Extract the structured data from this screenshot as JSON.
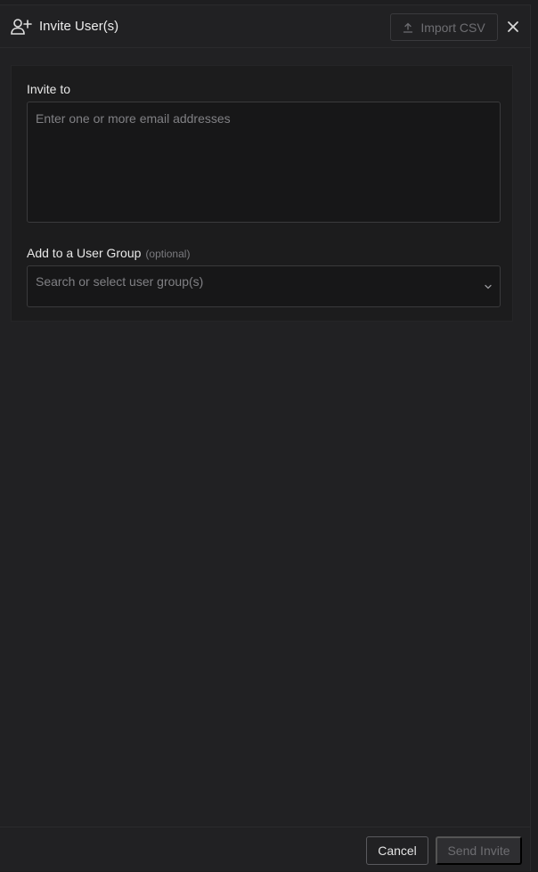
{
  "dialog": {
    "title": "Invite User(s)",
    "import_label": "Import CSV"
  },
  "form": {
    "invite_to_label": "Invite to",
    "email_placeholder": "Enter one or more email addresses",
    "group_label": "Add to a User Group",
    "group_optional": "(optional)",
    "group_placeholder": "Search or select user group(s)"
  },
  "footer": {
    "cancel_label": "Cancel",
    "send_label": "Send Invite"
  },
  "icons": {
    "header": "user-plus-icon",
    "import": "upload-icon",
    "close": "close-icon",
    "select": "chevron-down-icon"
  },
  "colors": {
    "background": "#1e1e20",
    "panel": "#212123",
    "input_bg": "#171718",
    "muted_text": "#808084"
  }
}
